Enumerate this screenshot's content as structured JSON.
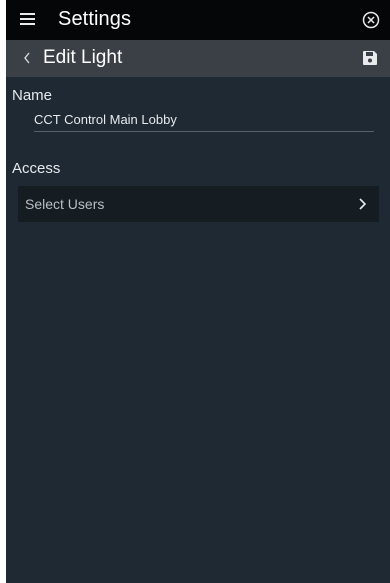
{
  "header": {
    "title": "Settings",
    "menu_icon": "hamburger-menu-icon",
    "close_icon": "close-circle-icon"
  },
  "subheader": {
    "title": "Edit Light",
    "back_icon": "chevron-left-icon",
    "save_icon": "save-disk-icon"
  },
  "form": {
    "name_label": "Name",
    "name_value": "CCT Control Main Lobby",
    "access_label": "Access",
    "select_users_label": "Select Users",
    "select_users_icon": "chevron-right-icon"
  },
  "colors": {
    "header_bg": "#050607",
    "subheader_bg": "#3a4046",
    "page_bg": "#1f2933",
    "row_bg": "#151c22",
    "text": "#e6e9ec"
  }
}
